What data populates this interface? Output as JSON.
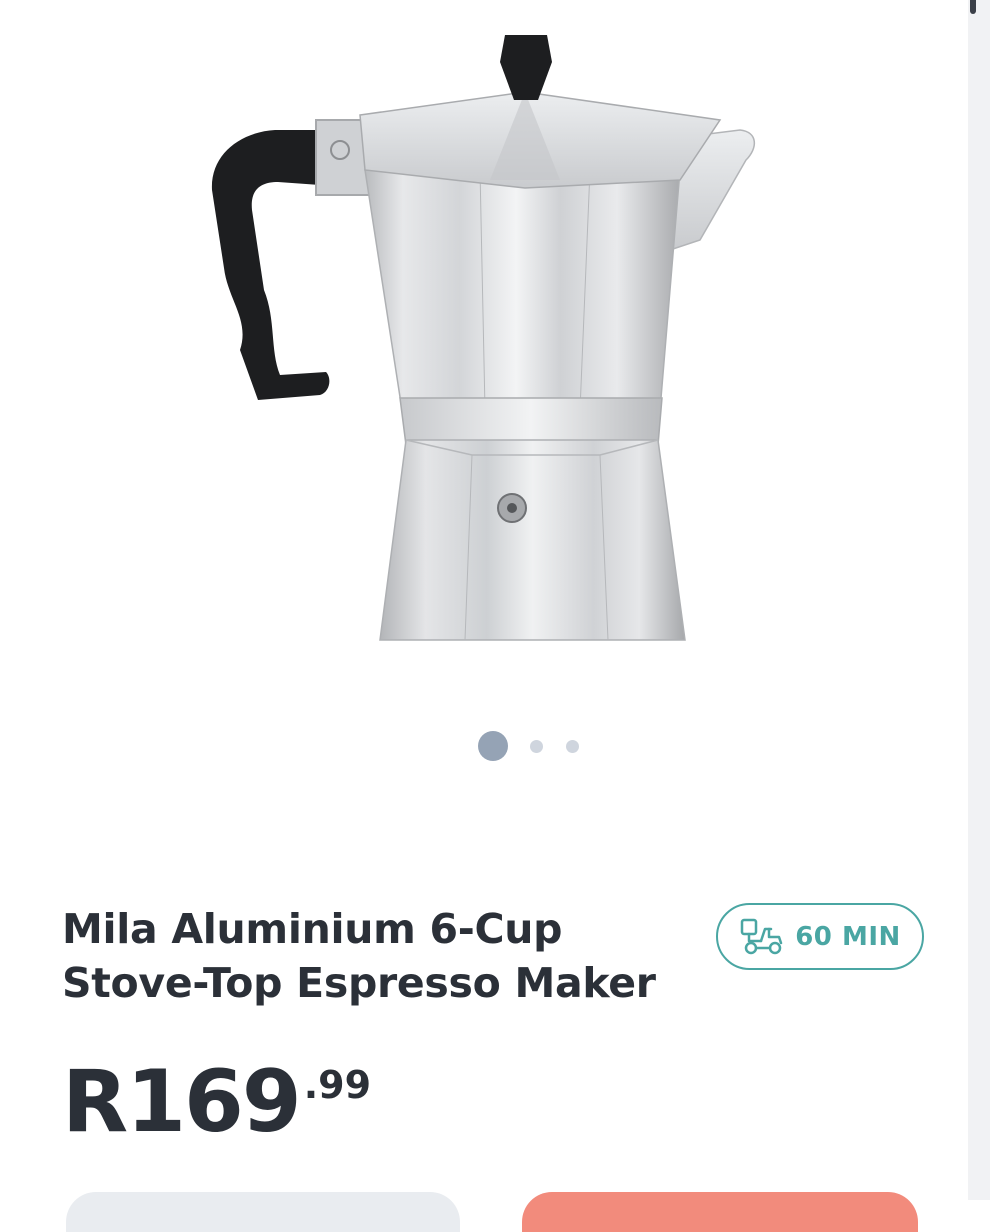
{
  "product": {
    "title_line1": "Mila Aluminium 6-Cup",
    "title_line2": "Stove-Top Espresso Maker",
    "image_alt": "Aluminium stove-top espresso maker",
    "image_icon": "espresso-maker"
  },
  "carousel": {
    "total": 3,
    "active_index": 0
  },
  "delivery": {
    "label": "60 MIN",
    "icon": "scooter-icon",
    "color": "#4aa6a3"
  },
  "price": {
    "main": "R169",
    "cents": ".99"
  },
  "colors": {
    "text": "#2b3038",
    "accent": "#4aa6a3",
    "primary_button": "#f28b7c",
    "secondary_button": "#e9ecf0",
    "dot_active": "#95a3b5",
    "dot_inactive": "#cfd5de"
  }
}
